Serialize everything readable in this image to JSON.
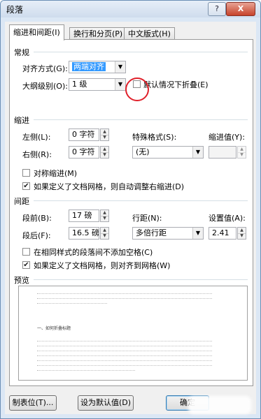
{
  "title": "段落",
  "titlebar": {
    "help_label": "?",
    "close_label": "X"
  },
  "tabs": [
    {
      "label": "缩进和间距(I)",
      "active": true
    },
    {
      "label": "换行和分页(P)",
      "active": false
    },
    {
      "label": "中文版式(H)",
      "active": false
    }
  ],
  "general": {
    "header": "常规",
    "alignment_label": "对齐方式(G):",
    "alignment_value": "两端对齐",
    "outline_label": "大纲级别(O):",
    "outline_value": "1 级",
    "collapse_label": "默认情况下折叠(E)",
    "collapse_checked": false
  },
  "indent": {
    "header": "缩进",
    "left_label": "左侧(L):",
    "left_value": "0 字符",
    "right_label": "右侧(R):",
    "right_value": "0 字符",
    "special_label": "特殊格式(S):",
    "special_value": "(无)",
    "by_label": "缩进值(Y):",
    "by_value": "",
    "mirror_label": "对称缩进(M)",
    "mirror_checked": false,
    "autoadjust_label": "如果定义了文档网格，则自动调整右缩进(D)",
    "autoadjust_checked": true
  },
  "spacing": {
    "header": "间距",
    "before_label": "段前(B):",
    "before_value": "17 磅",
    "after_label": "段后(F):",
    "after_value": "16.5 磅",
    "line_label": "行距(N):",
    "line_value": "多倍行距",
    "at_label": "设置值(A):",
    "at_value": "2.41",
    "nospace_label": "在相同样式的段落间不添加空格(C)",
    "nospace_checked": false,
    "snap_label": "如果定义了文档网格，则对齐到网格(W)",
    "snap_checked": true
  },
  "preview": {
    "header": "预览",
    "sample_text": "一、如何折叠标题"
  },
  "buttons": {
    "tabs_label": "制表位(T)...",
    "default_label": "设为默认值(D)",
    "ok_label": "确定"
  },
  "colors": {
    "annotation_circle": "#e0202a",
    "selection": "#3399ff"
  }
}
